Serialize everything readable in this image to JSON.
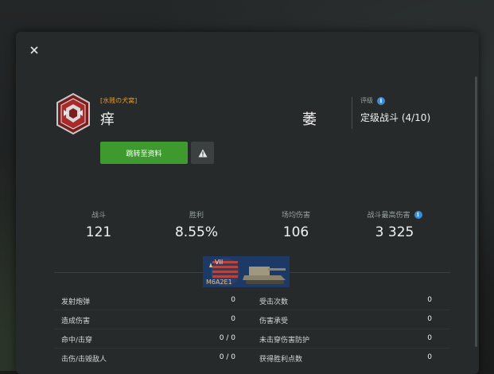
{
  "player": {
    "clan": "[水贱の犬窝]",
    "name": "痒",
    "name_right": "萎",
    "rating_label": "评级",
    "rating_value": "定级战斗 (4/10)"
  },
  "actions": {
    "profile_label": "跳转至资料"
  },
  "stats": [
    {
      "label": "战斗",
      "value": "121",
      "info": false
    },
    {
      "label": "胜利",
      "value": "8.55%",
      "info": false
    },
    {
      "label": "场均伤害",
      "value": "106",
      "info": false
    },
    {
      "label": "战斗最高伤害",
      "value": "3 325",
      "info": true
    }
  ],
  "tank": {
    "tier": "VII",
    "name": "M6A2E1"
  },
  "details": [
    {
      "left_label": "发射炮弹",
      "left_value": "0",
      "right_label": "受击次数",
      "right_value": "0"
    },
    {
      "left_label": "造成伤害",
      "left_value": "0",
      "right_label": "伤害承受",
      "right_value": "0"
    },
    {
      "left_label": "命中/击穿",
      "left_value": "0 / 0",
      "right_label": "未击穿伤害防护",
      "right_value": "0"
    },
    {
      "left_label": "击伤/击毁敌人",
      "left_value": "0 / 0",
      "right_label": "获得胜利点数",
      "right_value": "0"
    }
  ],
  "colors": {
    "accent_green": "#3e9a2f",
    "clan_orange": "#e89a2b",
    "info_blue": "#3a8bd8"
  }
}
